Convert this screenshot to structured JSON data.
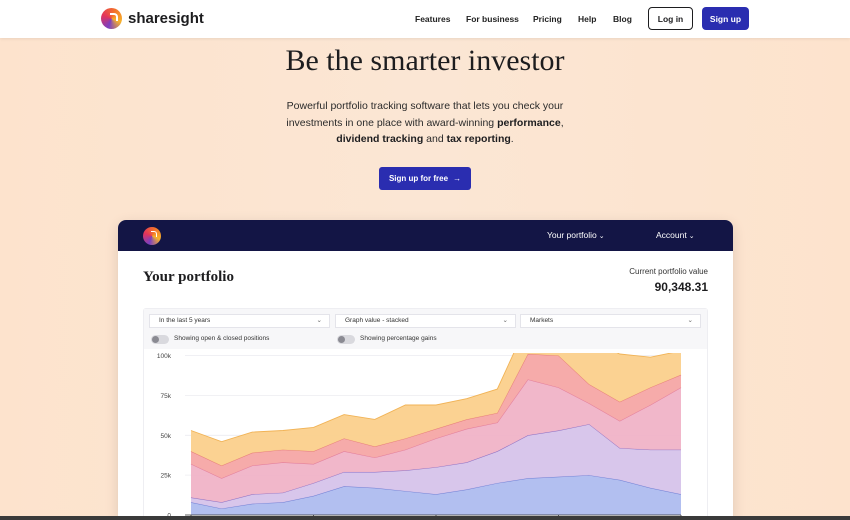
{
  "header": {
    "brand": "sharesight",
    "nav": [
      "Features",
      "For business",
      "Pricing",
      "Help",
      "Blog"
    ],
    "login_label": "Log in",
    "signup_label": "Sign up"
  },
  "hero": {
    "title": "Be the smarter investor",
    "sub_part1": "Powerful portfolio tracking software that lets you check your investments in one place with award-winning ",
    "sub_bold1": "performance",
    "sub_part2": ", ",
    "sub_bold2": "dividend tracking",
    "sub_part3": " and ",
    "sub_bold3": "tax reporting",
    "sub_part4": ".",
    "cta_label": "Sign up for free",
    "cta_arrow": "→"
  },
  "app": {
    "menu_portfolio": "Your portfolio",
    "menu_account": "Account",
    "chevron": "⌄",
    "title": "Your portfolio",
    "value_label": "Current portfolio value",
    "value": "90,348.31",
    "filters": {
      "period": "In the last 5 years",
      "graph": "Graph value - stacked",
      "markets": "Markets",
      "caret": "⌄",
      "toggle1": "Showing open & closed positions",
      "toggle2": "Showing percentage gains"
    }
  },
  "colors": {
    "brand_blue": "#2a2db0",
    "app_bar": "#131545",
    "series_blue": "#aebcef",
    "series_purple": "#d6c3ea",
    "series_pink": "#f0b3c7",
    "series_red": "#f5a7a5",
    "series_orange": "#fbd08c"
  },
  "chart_data": {
    "type": "area",
    "stacked": true,
    "ylim": [
      0,
      100000
    ],
    "yticks": [
      "0",
      "25k",
      "50k",
      "75k",
      "100k"
    ],
    "x": [
      0,
      1,
      2,
      3,
      4,
      5,
      6,
      7,
      8,
      9,
      10,
      11,
      12,
      13,
      14,
      15,
      16
    ],
    "series": [
      {
        "values": [
          8000,
          4000,
          7000,
          8000,
          12000,
          18000,
          17000,
          15000,
          13000,
          16000,
          20000,
          23000,
          24000,
          25000,
          22000,
          17000,
          13000
        ]
      },
      {
        "values": [
          3000,
          4000,
          6000,
          6000,
          8000,
          9000,
          10000,
          13000,
          17000,
          17000,
          20000,
          27000,
          29000,
          32000,
          20000,
          24000,
          28000
        ]
      },
      {
        "values": [
          21000,
          15000,
          18000,
          19000,
          12000,
          13000,
          9000,
          13000,
          18000,
          21000,
          18000,
          35000,
          27000,
          13000,
          17000,
          28000,
          39000
        ]
      },
      {
        "values": [
          8000,
          8000,
          8000,
          8000,
          8000,
          8000,
          7000,
          7000,
          6000,
          6000,
          6000,
          16000,
          20000,
          12000,
          12000,
          11000,
          8000
        ]
      },
      {
        "values": [
          13000,
          15000,
          13000,
          12000,
          15000,
          15000,
          17000,
          21000,
          15000,
          13000,
          15000,
          20000,
          17000,
          28000,
          30000,
          19000,
          15000
        ]
      }
    ]
  }
}
